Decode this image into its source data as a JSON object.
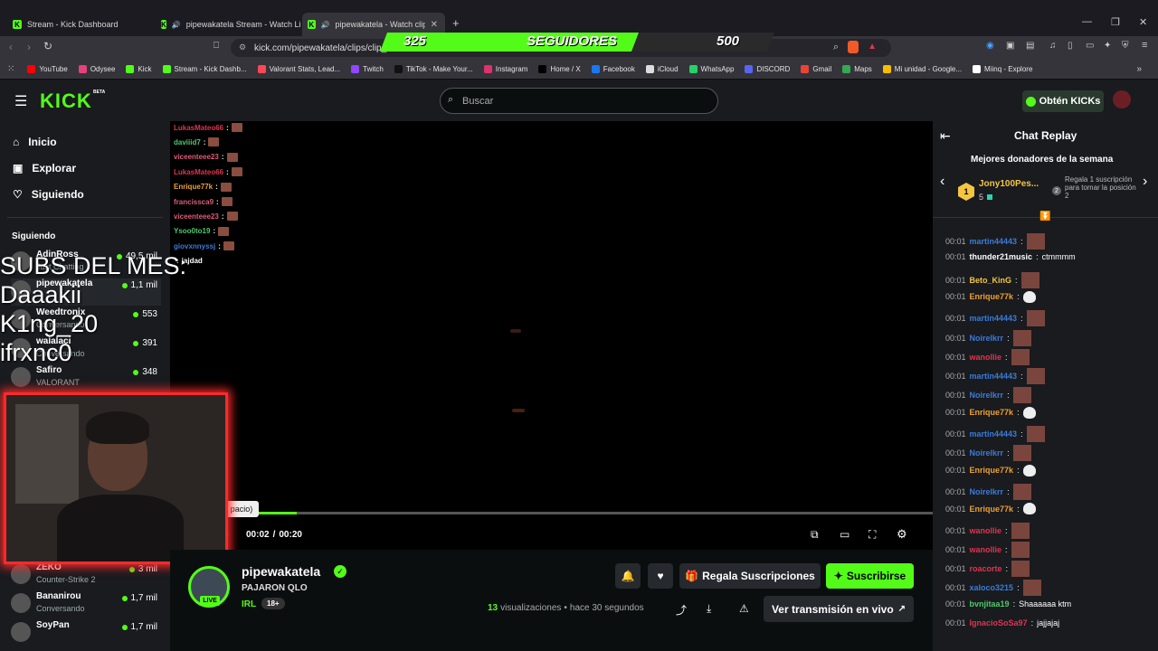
{
  "browser": {
    "tabs": [
      {
        "title": "Stream - Kick Dashboard"
      },
      {
        "title": "pipewakatela Stream - Watch Live"
      },
      {
        "title": "pipewakatela - Watch clips or"
      }
    ],
    "url": "kick.com/pipewakatela/clips/clip_",
    "bookmarks": [
      {
        "label": "YouTube",
        "color": "#ff0000"
      },
      {
        "label": "Odysee",
        "color": "#e5417a"
      },
      {
        "label": "Kick",
        "color": "#53fc18"
      },
      {
        "label": "Stream - Kick Dashb...",
        "color": "#53fc18"
      },
      {
        "label": "Valorant Stats, Lead...",
        "color": "#ff4655"
      },
      {
        "label": "Twitch",
        "color": "#9146ff"
      },
      {
        "label": "TikTok - Make Your...",
        "color": "#111111"
      },
      {
        "label": "Instagram",
        "color": "#e1306c"
      },
      {
        "label": "Home / X",
        "color": "#000000"
      },
      {
        "label": "Facebook",
        "color": "#1877f2"
      },
      {
        "label": "iCloud",
        "color": "#dddddd"
      },
      {
        "label": "WhatsApp",
        "color": "#25d366"
      },
      {
        "label": "DISCORD",
        "color": "#5865f2"
      },
      {
        "label": "Gmail",
        "color": "#ea4335"
      },
      {
        "label": "Maps",
        "color": "#34a853"
      },
      {
        "label": "Mi unidad - Google...",
        "color": "#fbbc04"
      },
      {
        "label": "Miinq - Explore",
        "color": "#ffffff"
      }
    ]
  },
  "overlay": {
    "follow_current": "325",
    "follow_label": "SEGUIDORES",
    "follow_goal": "500",
    "subs_title": "SUBS DEL MES:",
    "subs": [
      "Daaakii",
      "K1ng_20",
      "ifrxnc0"
    ]
  },
  "kick": {
    "logo": "KICK",
    "logo_beta": "BETA",
    "search_placeholder": "Buscar",
    "get_kicks": "Obtén KICKs"
  },
  "sidebar": {
    "nav": [
      {
        "label": "Inicio",
        "icon": "home-icon"
      },
      {
        "label": "Explorar",
        "icon": "explore-icon"
      },
      {
        "label": "Siguiendo",
        "icon": "heart-icon"
      }
    ],
    "following_title": "Siguiendo",
    "channels": [
      {
        "name": "AdinRoss",
        "category": "Just Chatting",
        "viewers": "49,5 mil"
      },
      {
        "name": "pipewakatela",
        "category": "",
        "viewers": "1,1 mil"
      },
      {
        "name": "Weedtronix",
        "category": "Conversando",
        "viewers": "553"
      },
      {
        "name": "walalaci",
        "category": "Conversando",
        "viewers": "391"
      },
      {
        "name": "Safiro",
        "category": "VALORANT",
        "viewers": "348"
      },
      {
        "name": "ZEKO",
        "category": "Counter-Strike 2",
        "viewers": "3 mil"
      },
      {
        "name": "Bananirou",
        "category": "Conversando",
        "viewers": "1,7 mil"
      },
      {
        "name": "SoyPan",
        "category": "",
        "viewers": "1,7 mil"
      }
    ]
  },
  "video": {
    "time_current": "00:02",
    "time_total": "00:20",
    "tooltip": "pacio)",
    "progress": 0.1,
    "stream_chat": [
      {
        "user": "LukasMateo66",
        "color": "#e0344f",
        "text": ""
      },
      {
        "user": "daviiid7",
        "color": "#4ec96a",
        "text": ""
      },
      {
        "user": "viceenteee23",
        "color": "#e05a7a",
        "text": ""
      },
      {
        "user": "LukasMateo66",
        "color": "#e0344f",
        "text": ""
      },
      {
        "user": "Enrique77k",
        "color": "#f0a030",
        "text": ""
      },
      {
        "user": "francissca9",
        "color": "#e05a7a",
        "text": ""
      },
      {
        "user": "viceenteee23",
        "color": "#e05a7a",
        "text": ""
      },
      {
        "user": "Ysoo0to19",
        "color": "#4ec96a",
        "text": ""
      },
      {
        "user": "giovxnnyssj",
        "color": "#3b7bd6",
        "text": ""
      },
      {
        "user": "",
        "color": "#e0344f",
        "text": "jajdad"
      }
    ]
  },
  "info": {
    "channel": "pipewakatela",
    "title": "PAJARON QLO",
    "tag1": "IRL",
    "tag2": "18+",
    "live": "LIVE",
    "views_count": "13",
    "views_label": "visualizaciones",
    "time_ago": "hace 30 segundos",
    "gift_label": "Regala Suscripciones",
    "subscribe_label": "Suscribirse",
    "live_label": "Ver transmisión en vivo"
  },
  "chat": {
    "title": "Chat Replay",
    "donors_title": "Mejores donadores de la semana",
    "donor_name": "Jony100Pes...",
    "donor_count": "5",
    "gift_prompt": "Regala 1 suscripción para tomar la posición 2",
    "messages": [
      {
        "time": "00:01",
        "user": "martin44443",
        "color": "#3b7bd6",
        "text": "",
        "emote": "pic"
      },
      {
        "time": "00:01",
        "user": "thunder21music",
        "color": "#ffffff",
        "text": "ctmmmm",
        "emote": ""
      },
      {
        "time": "00:01",
        "user": "Beto_KinG",
        "color": "#f5c542",
        "text": "",
        "emote": "pic"
      },
      {
        "time": "00:01",
        "user": "Enrique77k",
        "color": "#f0a030",
        "text": "",
        "emote": "skull"
      },
      {
        "time": "00:01",
        "user": "martin44443",
        "color": "#3b7bd6",
        "text": "",
        "emote": "pic"
      },
      {
        "time": "00:01",
        "user": "Noirelkrr",
        "color": "#3b7bd6",
        "text": "",
        "emote": "pic"
      },
      {
        "time": "00:01",
        "user": "wanollie",
        "color": "#e0344f",
        "text": "",
        "emote": "pic"
      },
      {
        "time": "00:01",
        "user": "martin44443",
        "color": "#3b7bd6",
        "text": "",
        "emote": "pic"
      },
      {
        "time": "00:01",
        "user": "Noirelkrr",
        "color": "#3b7bd6",
        "text": "",
        "emote": "pic"
      },
      {
        "time": "00:01",
        "user": "Enrique77k",
        "color": "#f0a030",
        "text": "",
        "emote": "skull"
      },
      {
        "time": "00:01",
        "user": "martin44443",
        "color": "#3b7bd6",
        "text": "",
        "emote": "pic"
      },
      {
        "time": "00:01",
        "user": "Noirelkrr",
        "color": "#3b7bd6",
        "text": "",
        "emote": "pic"
      },
      {
        "time": "00:01",
        "user": "Enrique77k",
        "color": "#f0a030",
        "text": "",
        "emote": "skull"
      },
      {
        "time": "00:01",
        "user": "Noirelkrr",
        "color": "#3b7bd6",
        "text": "",
        "emote": "pic"
      },
      {
        "time": "00:01",
        "user": "Enrique77k",
        "color": "#f0a030",
        "text": "",
        "emote": "skull"
      },
      {
        "time": "00:01",
        "user": "wanollie",
        "color": "#e0344f",
        "text": "",
        "emote": "pic"
      },
      {
        "time": "00:01",
        "user": "wanollie",
        "color": "#e0344f",
        "text": "",
        "emote": "pic"
      },
      {
        "time": "00:01",
        "user": "roacorte",
        "color": "#e0344f",
        "text": "",
        "emote": "pic"
      },
      {
        "time": "00:01",
        "user": "xaloco3215",
        "color": "#3b7bd6",
        "text": "",
        "emote": "pic"
      },
      {
        "time": "00:01",
        "user": "bvnjitaa19",
        "color": "#4ec96a",
        "text": "Shaaaaaa ktm",
        "emote": ""
      },
      {
        "time": "00:01",
        "user": "IgnacioSoSa97",
        "color": "#e0344f",
        "text": "jajjajaj",
        "emote": ""
      }
    ]
  },
  "colors": {
    "accent": "#53fc18",
    "bg": "#0b0e0f",
    "panel": "#191b1f"
  }
}
